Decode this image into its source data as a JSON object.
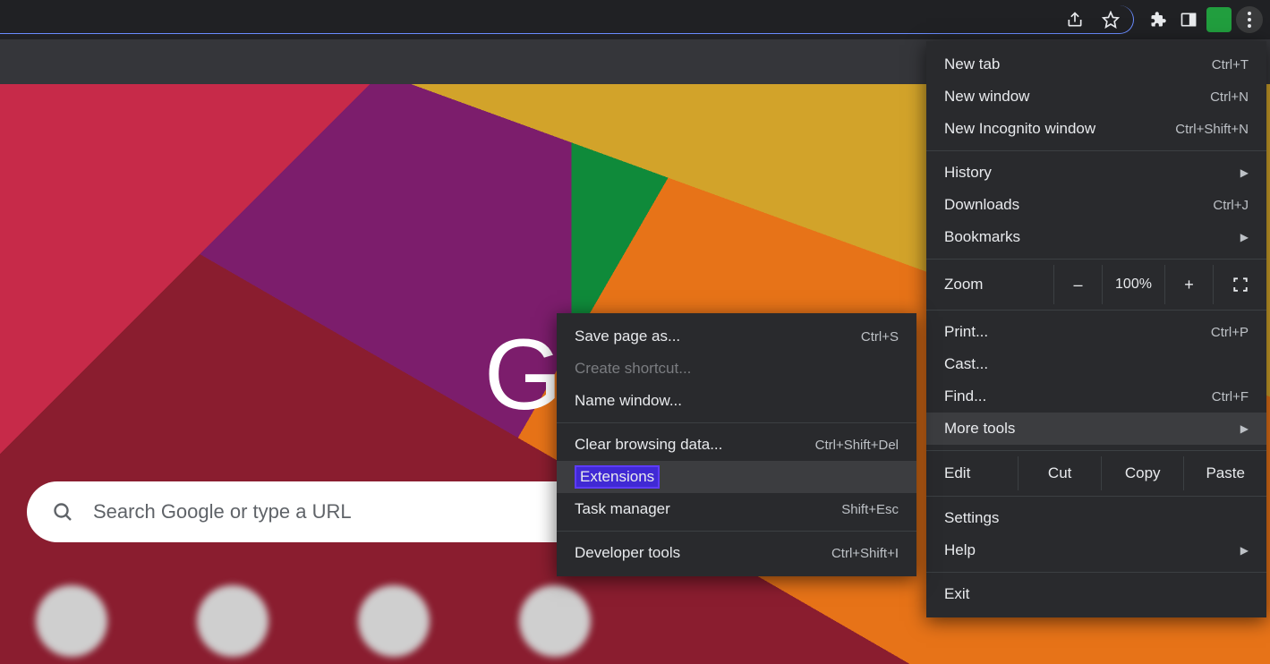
{
  "toolbar": {
    "share_icon": "share-icon",
    "star_icon": "star-icon",
    "extensions_icon": "puzzle-icon",
    "panel_icon": "side-panel-icon",
    "more_icon": "three-dot-icon"
  },
  "page": {
    "logo_text": "Google",
    "search_placeholder": "Search Google or type a URL"
  },
  "main_menu": {
    "section1": [
      {
        "label": "New tab",
        "shortcut": "Ctrl+T"
      },
      {
        "label": "New window",
        "shortcut": "Ctrl+N"
      },
      {
        "label": "New Incognito window",
        "shortcut": "Ctrl+Shift+N"
      }
    ],
    "section2": [
      {
        "label": "History",
        "submenu": true
      },
      {
        "label": "Downloads",
        "shortcut": "Ctrl+J"
      },
      {
        "label": "Bookmarks",
        "submenu": true
      }
    ],
    "zoom": {
      "label": "Zoom",
      "minus": "–",
      "value": "100%",
      "plus": "+"
    },
    "section3": [
      {
        "label": "Print...",
        "shortcut": "Ctrl+P"
      },
      {
        "label": "Cast..."
      },
      {
        "label": "Find...",
        "shortcut": "Ctrl+F"
      },
      {
        "label": "More tools",
        "submenu": true,
        "highlighted": true
      }
    ],
    "edit": {
      "label": "Edit",
      "cut": "Cut",
      "copy": "Copy",
      "paste": "Paste"
    },
    "section4": [
      {
        "label": "Settings"
      },
      {
        "label": "Help",
        "submenu": true
      }
    ],
    "section5": [
      {
        "label": "Exit"
      }
    ]
  },
  "more_tools_menu": {
    "section1": [
      {
        "label": "Save page as...",
        "shortcut": "Ctrl+S"
      },
      {
        "label": "Create shortcut...",
        "disabled": true
      },
      {
        "label": "Name window..."
      }
    ],
    "section2": [
      {
        "label": "Clear browsing data...",
        "shortcut": "Ctrl+Shift+Del"
      },
      {
        "label": "Extensions",
        "highlighted": true
      },
      {
        "label": "Task manager",
        "shortcut": "Shift+Esc"
      }
    ],
    "section3": [
      {
        "label": "Developer tools",
        "shortcut": "Ctrl+Shift+I"
      }
    ]
  }
}
